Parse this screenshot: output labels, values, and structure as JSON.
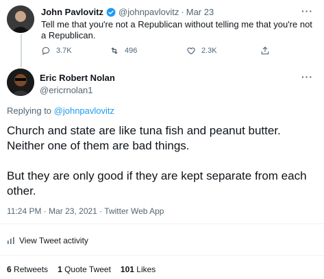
{
  "original_tweet": {
    "author_name": "John Pavlovitz",
    "handle": "@johnpavlovitz",
    "separator": "·",
    "date": "Mar 23",
    "text": "Tell me that you're not a Republican without telling me that you're not a Republican.",
    "reply_count": "3.7K",
    "retweet_count": "496",
    "like_count": "2.3K",
    "more_label": "···"
  },
  "reply_tweet": {
    "author_name": "Eric Robert Nolan",
    "handle": "@ericrnolan1",
    "replying_prefix": "Replying to ",
    "replying_to": "@johnpavlovitz",
    "text": "Church and state are like tuna fish and peanut butter. Neither one of them are bad things.\n\nBut they are only good if they are kept separate from each other.",
    "timestamp": "11:24 PM · Mar 23, 2021 · Twitter Web App",
    "more_label": "···",
    "activity_label": "View Tweet activity",
    "stats": {
      "retweets_count": "6",
      "retweets_label": "Retweets",
      "quotes_count": "1",
      "quotes_label": "Quote Tweet",
      "likes_count": "101",
      "likes_label": "Likes"
    }
  },
  "icons": [
    "verified-icon",
    "reply-icon",
    "retweet-icon",
    "like-icon",
    "share-icon",
    "activity-icon"
  ],
  "colors": {
    "accent": "#1d9bf0",
    "muted": "#536471",
    "text": "#0f1419"
  }
}
